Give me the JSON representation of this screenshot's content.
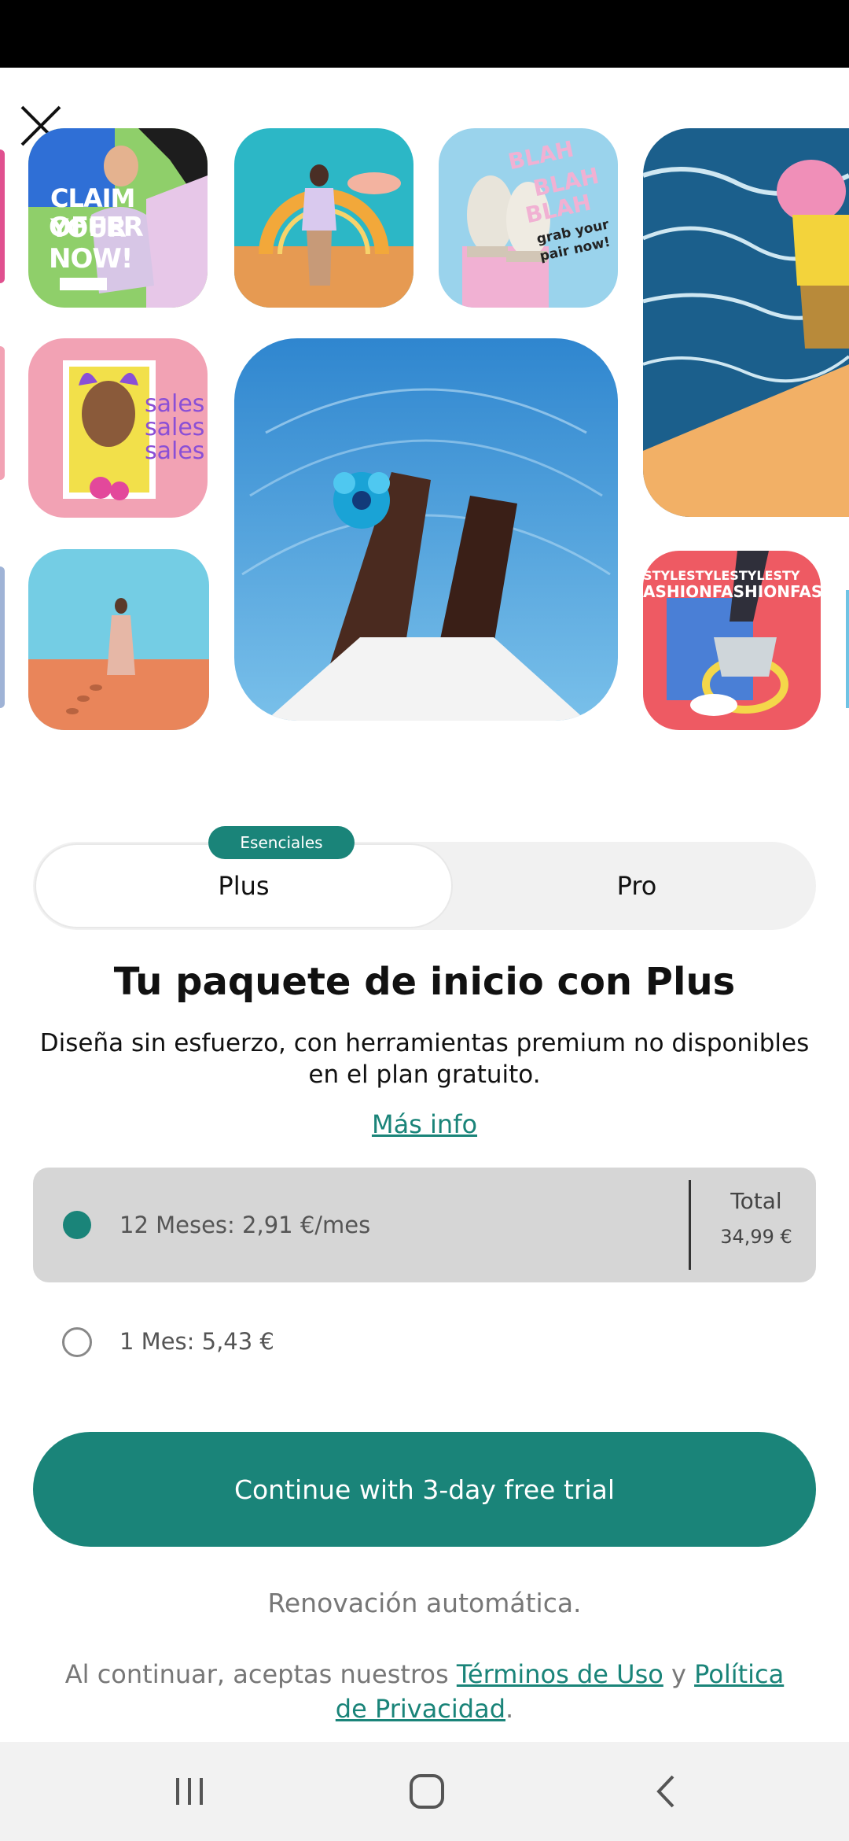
{
  "tiles": {
    "claim_line1": "CLAIM YOUR",
    "claim_line2": "OFFER NOW!",
    "blah1": "BLAH",
    "blah2": "BLAH",
    "blah3": "BLAH",
    "grab": "grab your",
    "pair": "pair now!",
    "sales1": "sales",
    "sales2": "sales",
    "sales3": "sales",
    "fashion1": "STYLESTYLESTYLESTY",
    "fashion2": "ASHIONFASHIONFASHI"
  },
  "plan_toggle": {
    "badge": "Esenciales",
    "plus": "Plus",
    "pro": "Pro",
    "selected": "Plus"
  },
  "offer": {
    "title": "Tu paquete de inicio con Plus",
    "subtitle": "Diseña sin esfuerzo, con herramientas premium no disponibles en el plan gratuito.",
    "more_info": "Más info"
  },
  "options": [
    {
      "label": "12 Meses: 2,91 €/mes",
      "total_label": "Total",
      "total_value": "34,99 €",
      "selected": true
    },
    {
      "label": "1 Mes: 5,43 €",
      "selected": false
    }
  ],
  "cta": "Continue with 3-day free trial",
  "renewal": "Renovación automática.",
  "legal": {
    "prefix": "Al continuar, aceptas nuestros",
    "terms": "Términos de Uso",
    "and": "y",
    "privacy": "Política de Privacidad",
    "suffix": "."
  },
  "colors": {
    "accent": "#1a8479",
    "selected_option_bg": "#d6d6d6",
    "toggle_bg": "#f1f1f1"
  },
  "icons": {
    "close": "close-icon",
    "recents": "recents-icon",
    "home": "home-icon",
    "back": "back-icon"
  }
}
